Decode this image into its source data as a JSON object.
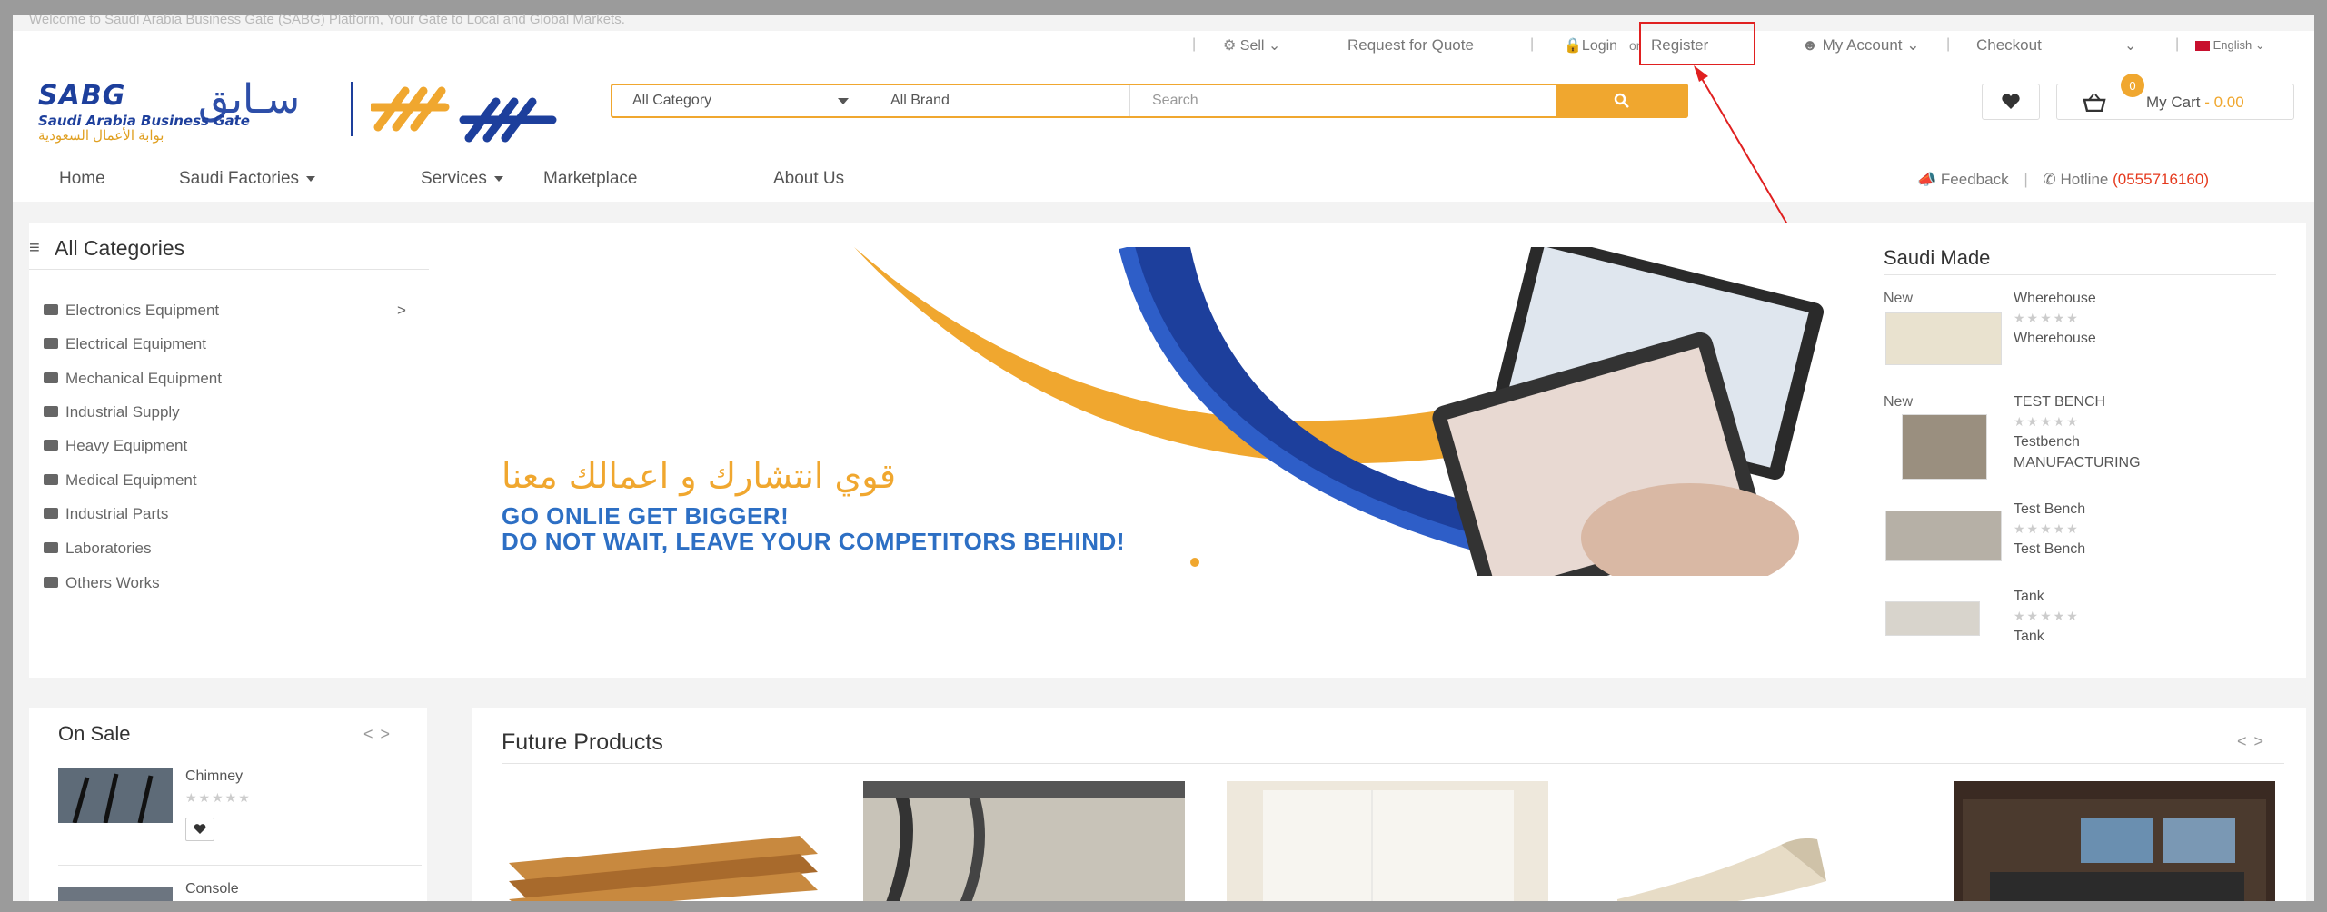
{
  "welcome_text": "Welcome to Saudi Arabia Business Gate (SABG) Platform, Your Gate to Local and Global Markets.",
  "toplinks": {
    "sell": "Sell",
    "rfq": "Request for Quote",
    "login": "Login",
    "or": "or",
    "register": "Register",
    "account": "My Account",
    "checkout": "Checkout",
    "language": "English"
  },
  "logo": {
    "en": "SABG",
    "ar": "سـابق",
    "sub_en": "Saudi Arabia Business Gate",
    "sub_ar": "بوابة الأعمال السعودية"
  },
  "search": {
    "category": "All Category",
    "brand": "All Brand",
    "placeholder": "Search"
  },
  "cart": {
    "count": "0",
    "label": "My Cart",
    "amount": "0.00"
  },
  "nav": {
    "home": "Home",
    "factories": "Saudi Factories",
    "services": "Services",
    "marketplace": "Marketplace",
    "about": "About Us",
    "feedback": "Feedback",
    "hotline_label": "Hotline",
    "hotline_number": "(0555716160)"
  },
  "categories": {
    "title": "All Categories",
    "items": [
      "Electronics Equipment",
      "Electrical Equipment",
      "Mechanical Equipment",
      "Industrial Supply",
      "Heavy Equipment",
      "Medical Equipment",
      "Industrial Parts",
      "Laboratories",
      "Others Works"
    ]
  },
  "banner": {
    "ar": "قوي انتشارك و اعمالك معنا",
    "line1": "GO ONLIE GET BIGGER!",
    "line2": "DO NOT WAIT, LEAVE YOUR COMPETITORS BEHIND!"
  },
  "saudi_made": {
    "title": "Saudi Made",
    "new_label": "New",
    "items": [
      {
        "name": "Wherehouse",
        "desc": "Wherehouse",
        "desc2": ""
      },
      {
        "name": "TEST BENCH",
        "desc": "Testbench",
        "desc2": "MANUFACTURING"
      },
      {
        "name": "Test Bench",
        "desc": "Test Bench",
        "desc2": ""
      },
      {
        "name": "Tank",
        "desc": "Tank",
        "desc2": ""
      }
    ]
  },
  "on_sale": {
    "title": "On Sale",
    "items": [
      "Chimney",
      "Console"
    ]
  },
  "future": {
    "title": "Future Products"
  },
  "colors": {
    "accent": "#f0a72f",
    "brand_blue": "#1d3f9c",
    "hotline": "#e53a1e",
    "annotation": "#e02020"
  }
}
